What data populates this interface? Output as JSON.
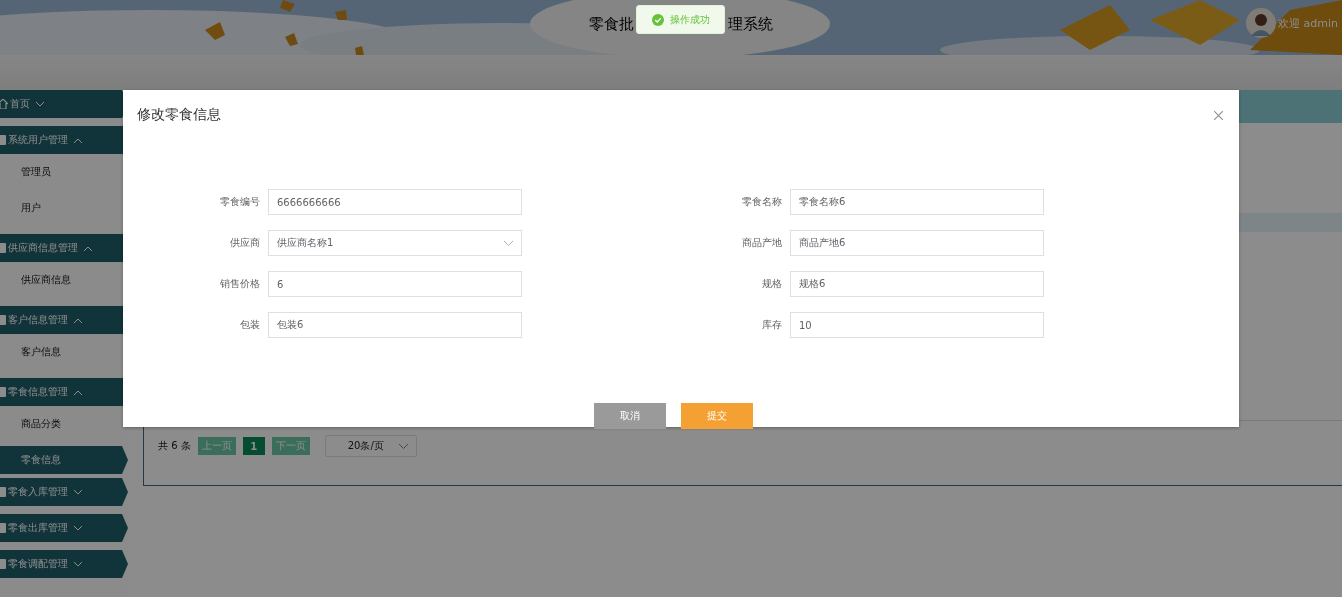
{
  "header": {
    "title_parts": [
      "零食批",
      "理系统"
    ],
    "welcome": "欢迎 admin"
  },
  "toast": {
    "message": "操作成功"
  },
  "sidebar": {
    "groups": [
      {
        "label": "首页",
        "expanded": false
      },
      {
        "label": "系统用户管理",
        "expanded": true,
        "children": [
          {
            "label": "管理员",
            "selected": false
          },
          {
            "label": "用户",
            "selected": false
          }
        ]
      },
      {
        "label": "供应商信息管理",
        "expanded": true,
        "children": [
          {
            "label": "供应商信息",
            "selected": false
          }
        ]
      },
      {
        "label": "客户信息管理",
        "expanded": true,
        "children": [
          {
            "label": "客户信息",
            "selected": false
          }
        ]
      },
      {
        "label": "零食信息管理",
        "expanded": true,
        "children": [
          {
            "label": "商品分类",
            "selected": false
          },
          {
            "label": "零食信息",
            "selected": true
          }
        ]
      },
      {
        "label": "零食入库管理",
        "expanded": false
      },
      {
        "label": "零食出库管理",
        "expanded": false
      },
      {
        "label": "零食调配管理",
        "expanded": false
      }
    ]
  },
  "pagination": {
    "total": "共 6 条",
    "prev": "上一页",
    "pages": [
      {
        "label": "1",
        "selected": true
      }
    ],
    "next": "下一页",
    "page_size": "20条/页"
  },
  "dialog": {
    "title": "修改零食信息",
    "fields": [
      {
        "label": "零食编号",
        "kind": "input",
        "value": "6666666666"
      },
      {
        "label": "零食名称",
        "kind": "input",
        "value": "零食名称6"
      },
      {
        "label": "供应商",
        "kind": "select",
        "value": "供应商名称1"
      },
      {
        "label": "商品产地",
        "kind": "input",
        "value": "商品产地6"
      },
      {
        "label": "销售价格",
        "kind": "input",
        "value": "6"
      },
      {
        "label": "规格",
        "kind": "input",
        "value": "规格6"
      },
      {
        "label": "包装",
        "kind": "input",
        "value": "包装6"
      },
      {
        "label": "库存",
        "kind": "input",
        "value": "10"
      }
    ],
    "buttons": [
      {
        "label": "取消",
        "kind": "cancel"
      },
      {
        "label": "提交",
        "kind": "primary"
      }
    ]
  }
}
